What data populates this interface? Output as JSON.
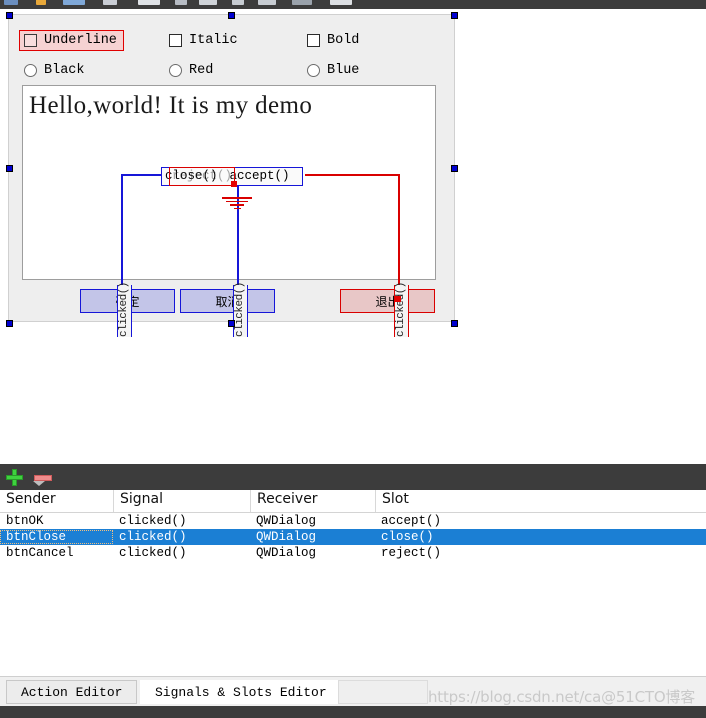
{
  "toolbar": {
    "icon_names": [
      "open-icon",
      "lightbulb-icon",
      "ruler-icon",
      "grid-icon",
      "layout-horizontal-icon",
      "layout-form-icon",
      "layout-grid-icon",
      "split-h-icon",
      "split-v-icon",
      "break-layout-icon",
      "adjust-size-icon"
    ]
  },
  "form": {
    "checkboxes": [
      {
        "label": "Underline",
        "selected": true
      },
      {
        "label": "Italic",
        "selected": false
      },
      {
        "label": "Bold",
        "selected": false
      }
    ],
    "radios": [
      {
        "label": "Black",
        "selected": false
      },
      {
        "label": "Red",
        "selected": false
      },
      {
        "label": "Blue",
        "selected": false
      }
    ],
    "text_content": "Hello,world!  It is my demo",
    "buttons": [
      {
        "label": "确定",
        "color": "blue",
        "signal": "clicked()"
      },
      {
        "label": "取消",
        "color": "blue",
        "signal": "clicked()"
      },
      {
        "label": "退出",
        "color": "red",
        "signal": "clicked()"
      }
    ],
    "connection_labels": {
      "close": "close()",
      "accept": "accept()",
      "reject": "reject()"
    },
    "colors": {
      "selection_handle": "#0000d0",
      "connection_blue": "#1616d8",
      "connection_red": "#d90000",
      "button_blue_fill": "#c3c5e8",
      "button_red_fill": "#e8c7c7",
      "selected_widget_fill": "#f6d2d2"
    }
  },
  "editor": {
    "add_label": "+",
    "remove_label": "−",
    "columns": [
      "Sender",
      "Signal",
      "Receiver",
      "Slot"
    ],
    "rows": [
      {
        "sender": "btnOK",
        "signal": "clicked()",
        "receiver": "QWDialog",
        "slot": "accept()",
        "selected": false
      },
      {
        "sender": "btnClose",
        "signal": "clicked()",
        "receiver": "QWDialog",
        "slot": "close()",
        "selected": true
      },
      {
        "sender": "btnCancel",
        "signal": "clicked()",
        "receiver": "QWDialog",
        "slot": "reject()",
        "selected": false
      }
    ],
    "selected_row_color": "#1b7fd4"
  },
  "tabs": [
    {
      "label": "Action Editor",
      "active": false
    },
    {
      "label": "Signals & Slots Editor",
      "active": true
    }
  ],
  "watermark": "https://blog.csdn.net/ca@51CTO博客"
}
